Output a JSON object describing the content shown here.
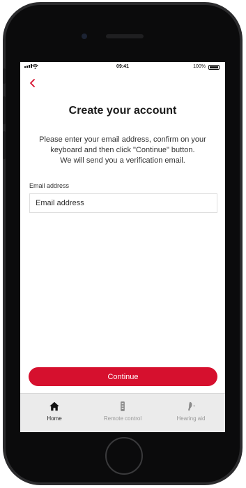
{
  "status_bar": {
    "time": "09:41",
    "battery": "100%"
  },
  "header": {
    "back_icon": "chevron-left-icon",
    "title": "Create your account"
  },
  "description": {
    "line1": "Please enter your email address, confirm on your",
    "line2": "keyboard and then click \"Continue\" button.",
    "line3": "We will send you a verification email."
  },
  "form": {
    "email_label": "Email address",
    "email_placeholder": "Email address",
    "email_value": ""
  },
  "actions": {
    "continue_label": "Continue"
  },
  "tabs": [
    {
      "label": "Home",
      "icon": "home-icon",
      "active": true
    },
    {
      "label": "Remote control",
      "icon": "remote-control-icon",
      "active": false
    },
    {
      "label": "Hearing aid",
      "icon": "hearing-aid-icon",
      "active": false
    }
  ],
  "colors": {
    "accent": "#d6102e",
    "tab_bar_bg": "#ebebeb",
    "inactive_tab": "#9a9a9a"
  }
}
